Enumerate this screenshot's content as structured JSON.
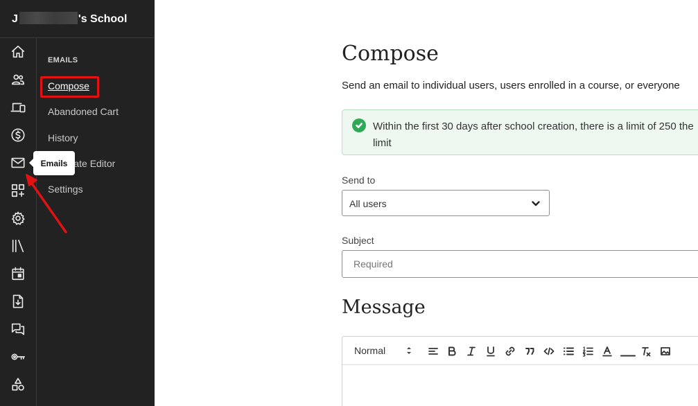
{
  "app": {
    "school_initial": "J",
    "school_suffix": "'s School"
  },
  "rail": {
    "icons": [
      "home-icon",
      "users-icon",
      "devices-icon",
      "dollar-icon",
      "mail-icon",
      "apps-add-icon",
      "gear-icon",
      "library-icon",
      "calendar-icon",
      "download-file-icon",
      "chat-icon",
      "key-icon",
      "shapes-icon"
    ]
  },
  "subnav": {
    "section_title": "EMAILS",
    "items": [
      {
        "label": "Compose"
      },
      {
        "label": "Abandoned Cart"
      },
      {
        "label": "History"
      },
      {
        "label": "Template Editor"
      },
      {
        "label": "Settings"
      }
    ]
  },
  "tooltip": {
    "label": "Emails"
  },
  "main": {
    "title": "Compose",
    "description": "Send an email to individual users, users enrolled in a course, or everyone",
    "notice": "Within the first 30 days after school creation, there is a limit of 250 the limit",
    "send_to_label": "Send to",
    "send_to_value": "All users",
    "subject_label": "Subject",
    "subject_placeholder": "Required",
    "message_title": "Message"
  },
  "editor": {
    "format_value": "Normal",
    "toolbar": [
      "align-left-icon",
      "bold-icon",
      "italic-icon",
      "underline-icon",
      "link-icon",
      "quote-icon",
      "code-icon",
      "bullet-list-icon",
      "numbered-list-icon",
      "text-color-icon",
      "highlight-icon",
      "clear-format-icon",
      "image-icon"
    ]
  },
  "colors": {
    "sidebar_bg": "#222222",
    "highlight_red": "#e01212",
    "success_green": "#2eaa57",
    "notice_bg": "#eef8f1"
  }
}
